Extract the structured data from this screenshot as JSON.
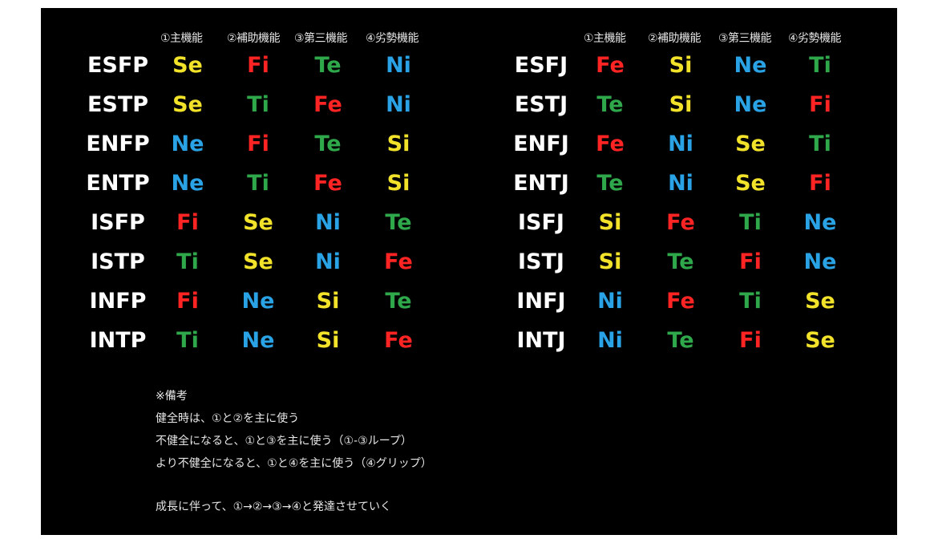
{
  "headers": [
    "①主機能",
    "②補助機能",
    "③第三機能",
    "④劣勢機能"
  ],
  "colors": {
    "Se": "#f2e22a",
    "Si": "#f2e22a",
    "Fi": "#ff2424",
    "Fe": "#ff2424",
    "Te": "#2fa84c",
    "Ti": "#2fa84c",
    "Ni": "#2aa3e6",
    "Ne": "#2aa3e6"
  },
  "left_types": [
    {
      "type": "ESFP",
      "functions": [
        "Se",
        "Fi",
        "Te",
        "Ni"
      ]
    },
    {
      "type": "ESTP",
      "functions": [
        "Se",
        "Ti",
        "Fe",
        "Ni"
      ]
    },
    {
      "type": "ENFP",
      "functions": [
        "Ne",
        "Fi",
        "Te",
        "Si"
      ]
    },
    {
      "type": "ENTP",
      "functions": [
        "Ne",
        "Ti",
        "Fe",
        "Si"
      ]
    },
    {
      "type": "ISFP",
      "functions": [
        "Fi",
        "Se",
        "Ni",
        "Te"
      ]
    },
    {
      "type": "ISTP",
      "functions": [
        "Ti",
        "Se",
        "Ni",
        "Fe"
      ]
    },
    {
      "type": "INFP",
      "functions": [
        "Fi",
        "Ne",
        "Si",
        "Te"
      ]
    },
    {
      "type": "INTP",
      "functions": [
        "Ti",
        "Ne",
        "Si",
        "Fe"
      ]
    }
  ],
  "right_types": [
    {
      "type": "ESFJ",
      "functions": [
        "Fe",
        "Si",
        "Ne",
        "Ti"
      ]
    },
    {
      "type": "ESTJ",
      "functions": [
        "Te",
        "Si",
        "Ne",
        "Fi"
      ]
    },
    {
      "type": "ENFJ",
      "functions": [
        "Fe",
        "Ni",
        "Se",
        "Ti"
      ]
    },
    {
      "type": "ENTJ",
      "functions": [
        "Te",
        "Ni",
        "Se",
        "Fi"
      ]
    },
    {
      "type": "ISFJ",
      "functions": [
        "Si",
        "Fe",
        "Ti",
        "Ne"
      ]
    },
    {
      "type": "ISTJ",
      "functions": [
        "Si",
        "Te",
        "Fi",
        "Ne"
      ]
    },
    {
      "type": "INFJ",
      "functions": [
        "Ni",
        "Fe",
        "Ti",
        "Se"
      ]
    },
    {
      "type": "INTJ",
      "functions": [
        "Ni",
        "Te",
        "Fi",
        "Se"
      ]
    }
  ],
  "notes": [
    "※備考",
    "健全時は、①と②を主に使う",
    "不健全になると、①と③を主に使う（①-③ループ）",
    "より不健全になると、①と④を主に使う（④グリップ）",
    "",
    "成長に伴って、①→②→③→④と発達させていく"
  ]
}
